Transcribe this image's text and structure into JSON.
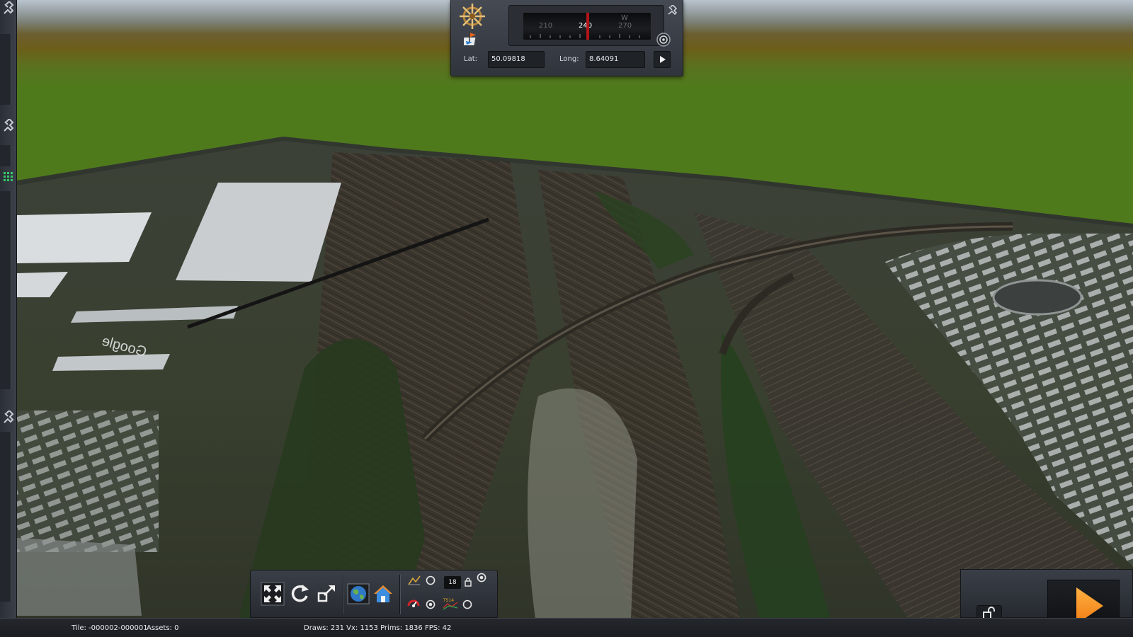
{
  "compass": {
    "ticks": [
      "210",
      "240",
      "270"
    ],
    "cardinal": "W",
    "heading": 240,
    "lat_label": "Lat:",
    "lat_value": "50.09818",
    "long_label": "Long:",
    "long_value": "8.64091"
  },
  "scene": {
    "watermark": "Google",
    "sky_color": "#b7c0c9",
    "horizon_color": "#5d6a3a"
  },
  "toolbar": {
    "counter": "18",
    "icons": [
      "fullscreen-icon",
      "reset-rotation-icon",
      "resize-icon",
      "world-map-icon",
      "home-icon",
      "terrain-tool-icon",
      "speed-icon",
      "lock-small-icon",
      "ts-icon"
    ],
    "ts_label": "TS14"
  },
  "status": {
    "tile": "Tile: -000002-000001",
    "assets": "Assets: 0",
    "perf": "Draws: 231 Vx: 1153 Prims: 1836 FPS: 42"
  }
}
